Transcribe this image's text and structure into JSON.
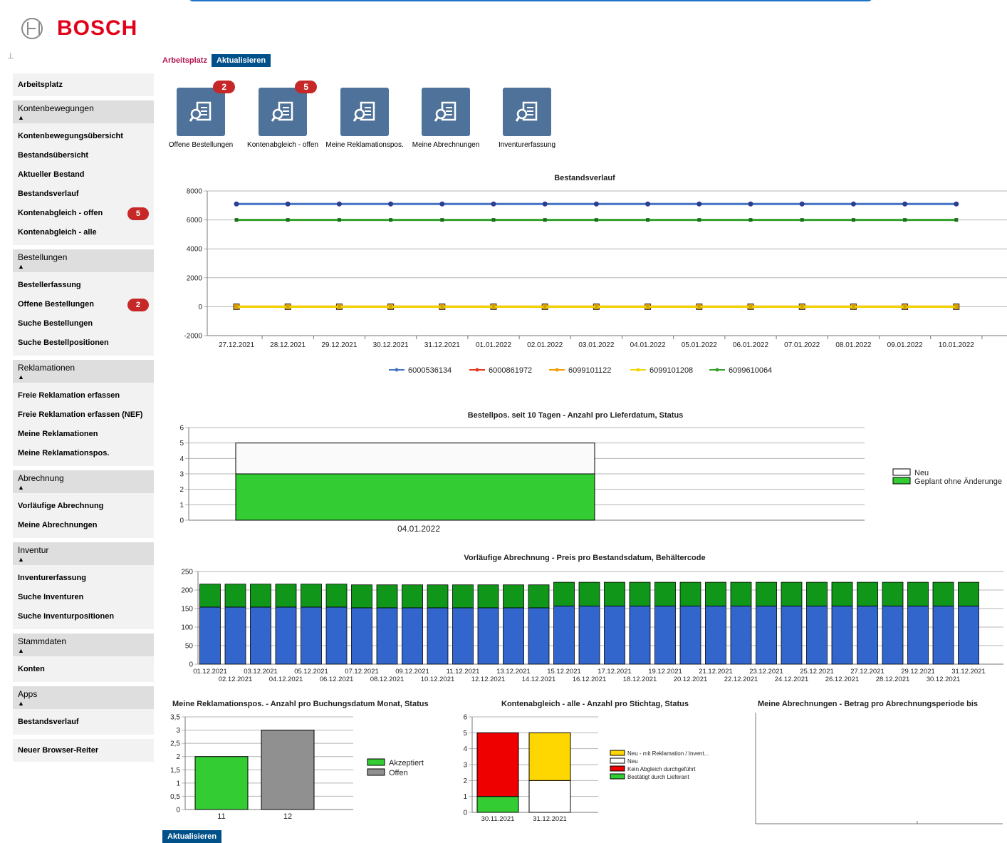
{
  "brand": "BOSCH",
  "breadcrumb": {
    "current": "Arbeitsplatz",
    "refresh_label": "Aktualisieren"
  },
  "footer": {
    "refresh_label": "Aktualisieren"
  },
  "sidebar": {
    "top_item": "Arbeitsplatz",
    "groups": [
      {
        "title": "Kontenbewegungen",
        "items": [
          {
            "label": "Kontenbewegungsübersicht"
          },
          {
            "label": "Bestandsübersicht"
          },
          {
            "label": "Aktueller Bestand"
          },
          {
            "label": "Bestandsverlauf"
          },
          {
            "label": "Kontenabgleich - offen",
            "badge": "5"
          },
          {
            "label": "Kontenabgleich - alle"
          }
        ]
      },
      {
        "title": "Bestellungen",
        "items": [
          {
            "label": "Bestellerfassung"
          },
          {
            "label": "Offene Bestellungen",
            "badge": "2"
          },
          {
            "label": "Suche Bestellungen"
          },
          {
            "label": "Suche Bestellpositionen"
          }
        ]
      },
      {
        "title": "Reklamationen",
        "items": [
          {
            "label": "Freie Reklamation erfassen"
          },
          {
            "label": "Freie Reklamation erfassen (NEF)"
          },
          {
            "label": "Meine Reklamationen"
          },
          {
            "label": "Meine Reklamationspos."
          }
        ]
      },
      {
        "title": "Abrechnung",
        "items": [
          {
            "label": "Vorläufige Abrechnung"
          },
          {
            "label": "Meine Abrechnungen"
          }
        ]
      },
      {
        "title": "Inventur",
        "items": [
          {
            "label": "Inventurerfassung"
          },
          {
            "label": "Suche Inventuren"
          },
          {
            "label": "Suche Inventurpositionen"
          }
        ]
      },
      {
        "title": "Stammdaten",
        "items": [
          {
            "label": "Konten"
          }
        ]
      },
      {
        "title": "Apps",
        "items": [
          {
            "label": "Bestandsverlauf"
          }
        ]
      }
    ],
    "bottom_item": "Neuer Browser-Reiter"
  },
  "tiles": [
    {
      "label": "Offene Bestellungen",
      "badge": "2",
      "icon": "document-search-icon"
    },
    {
      "label": "Kontenabgleich - offen",
      "badge": "5",
      "icon": "document-search-icon"
    },
    {
      "label": "Meine Reklamationspos.",
      "icon": "document-search-icon"
    },
    {
      "label": "Meine Abrechnungen",
      "icon": "document-search-icon"
    },
    {
      "label": "Inventurerfassung",
      "icon": "document-search-icon"
    }
  ],
  "chart_data": [
    {
      "type": "line",
      "title": "Bestandsverlauf",
      "x": [
        "27.12.2021",
        "28.12.2021",
        "29.12.2021",
        "30.12.2021",
        "31.12.2021",
        "01.01.2022",
        "02.01.2022",
        "03.01.2022",
        "04.01.2022",
        "05.01.2022",
        "06.01.2022",
        "07.01.2022",
        "08.01.2022",
        "09.01.2022",
        "10.01.2022"
      ],
      "ylim": [
        -2000,
        8000
      ],
      "yticks": [
        -2000,
        0,
        2000,
        4000,
        6000,
        8000
      ],
      "legend_position": "bottom",
      "series": [
        {
          "name": "6000536134",
          "color": "#4472c4",
          "marker": "circle",
          "values": [
            7100,
            7100,
            7100,
            7100,
            7100,
            7100,
            7100,
            7100,
            7100,
            7100,
            7100,
            7100,
            7100,
            7100,
            7100
          ]
        },
        {
          "name": "6000861972",
          "color": "#e8361a",
          "marker": "triangle",
          "values": [
            0,
            0,
            0,
            0,
            0,
            0,
            0,
            0,
            0,
            0,
            0,
            0,
            0,
            0,
            0
          ]
        },
        {
          "name": "6099101122",
          "color": "#f59b00",
          "marker": "square",
          "values": [
            0,
            0,
            0,
            0,
            0,
            0,
            0,
            0,
            0,
            0,
            0,
            0,
            0,
            0,
            0
          ]
        },
        {
          "name": "6099101208",
          "color": "#f2d600",
          "marker": "diamond",
          "values": [
            0,
            0,
            0,
            0,
            0,
            0,
            0,
            0,
            0,
            0,
            0,
            0,
            0,
            0,
            0
          ]
        },
        {
          "name": "6099610064",
          "color": "#33a02c",
          "marker": "cross",
          "values": [
            6000,
            6000,
            6000,
            6000,
            6000,
            6000,
            6000,
            6000,
            6000,
            6000,
            6000,
            6000,
            6000,
            6000,
            6000
          ]
        }
      ]
    },
    {
      "type": "bar",
      "stacked": true,
      "title": "Bestellpos. seit 10 Tagen - Anzahl pro Lieferdatum, Status",
      "categories": [
        "04.01.2022"
      ],
      "ylim": [
        0,
        6
      ],
      "yticks": [
        0,
        1,
        2,
        3,
        4,
        5,
        6
      ],
      "legend_position": "right",
      "series": [
        {
          "name": "Geplant ohne Änderunge",
          "color": "#33cc33",
          "values": [
            3
          ]
        },
        {
          "name": "Neu",
          "color": "#ffffff",
          "values": [
            2
          ]
        }
      ]
    },
    {
      "type": "bar",
      "stacked": true,
      "title": "Vorläufige Abrechnung -  Preis pro Bestandsdatum, Behältercode",
      "categories": [
        "01.12.2021",
        "02.12.2021",
        "03.12.2021",
        "04.12.2021",
        "05.12.2021",
        "06.12.2021",
        "07.12.2021",
        "08.12.2021",
        "09.12.2021",
        "10.12.2021",
        "11.12.2021",
        "12.12.2021",
        "13.12.2021",
        "14.12.2021",
        "15.12.2021",
        "16.12.2021",
        "17.12.2021",
        "18.12.2021",
        "19.12.2021",
        "20.12.2021",
        "21.12.2021",
        "22.12.2021",
        "23.12.2021",
        "24.12.2021",
        "25.12.2021",
        "26.12.2021",
        "27.12.2021",
        "28.12.2021",
        "29.12.2021",
        "30.12.2021",
        "31.12.2021"
      ],
      "ylim": [
        0,
        250
      ],
      "yticks": [
        0,
        50,
        100,
        150,
        200,
        250
      ],
      "series": [
        {
          "name": "",
          "color": "#3366cc",
          "values": [
            154,
            154,
            154,
            154,
            154,
            154,
            152,
            152,
            152,
            152,
            152,
            152,
            152,
            152,
            157,
            157,
            157,
            157,
            157,
            157,
            157,
            157,
            157,
            157,
            157,
            157,
            157,
            157,
            157,
            157,
            157
          ]
        },
        {
          "name": "",
          "color": "#109618",
          "values": [
            62,
            62,
            62,
            62,
            62,
            62,
            62,
            62,
            62,
            62,
            62,
            62,
            62,
            62,
            64,
            64,
            64,
            64,
            64,
            64,
            64,
            64,
            64,
            64,
            64,
            64,
            64,
            64,
            64,
            64,
            64
          ]
        }
      ]
    },
    {
      "type": "bar",
      "title": "Meine Reklamationspos. - Anzahl pro Buchungsdatum Monat, Status",
      "categories": [
        "11",
        "12"
      ],
      "ylim": [
        0,
        3.5
      ],
      "yticks": [
        "0",
        "0,5",
        "1",
        "1,5",
        "2",
        "2,5",
        "3",
        "3,5"
      ],
      "legend_position": "right",
      "series": [
        {
          "name": "Akzeptiert",
          "color": "#33cc33",
          "values": [
            2,
            0
          ]
        },
        {
          "name": "Offen",
          "color": "#909090",
          "values": [
            0,
            3
          ]
        }
      ]
    },
    {
      "type": "bar",
      "stacked": true,
      "title": "Kontenabgleich - alle - Anzahl pro Stichtag, Status",
      "categories": [
        "30.11.2021",
        "31.12.2021"
      ],
      "ylim": [
        0,
        6
      ],
      "yticks": [
        0,
        1,
        2,
        3,
        4,
        5,
        6
      ],
      "legend_position": "right",
      "series": [
        {
          "name": "Bestätigt durch Lieferant",
          "color": "#33cc33",
          "values": [
            1,
            0
          ]
        },
        {
          "name": "Kein Abgleich durchgeführt",
          "color": "#ee0000",
          "values": [
            4,
            0
          ]
        },
        {
          "name": "Neu",
          "color": "#ffffff",
          "values": [
            0,
            2
          ]
        },
        {
          "name": "Neu - mit Reklamation / Invent...",
          "color": "#ffd700",
          "values": [
            0,
            3
          ]
        }
      ]
    },
    {
      "type": "bar",
      "title": "Meine Abrechnungen - Betrag pro Abrechnungsperiode bis",
      "categories": [],
      "series": []
    }
  ]
}
